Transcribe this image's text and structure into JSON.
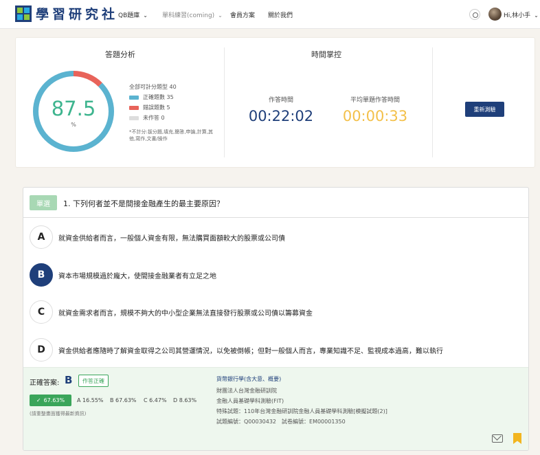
{
  "header": {
    "logo_text": "學習研究社",
    "nav": [
      {
        "label": "QB題庫",
        "has_caret": true
      },
      {
        "label": "單科練習(coming)",
        "has_caret": true
      },
      {
        "label": "會員方案"
      },
      {
        "label": "關於我們"
      }
    ],
    "user_greeting": "Hi,林小手"
  },
  "analysis": {
    "title": "答題分析",
    "score": "87.5",
    "score_unit": "%",
    "total_label": "全部可計分題型 40",
    "legend": [
      {
        "label": "正確題數 35",
        "color": "#5bb3d0"
      },
      {
        "label": "錯誤題數 5",
        "color": "#e8635a"
      },
      {
        "label": "未作答 0",
        "color": "#dddddd"
      }
    ],
    "gauge": {
      "correct": 35,
      "wrong": 5,
      "unanswered": 0,
      "total": 40
    },
    "note": "*不計分:拔分題,填充,簡答,申論,計算,其他,寫作,文書/操作"
  },
  "time": {
    "title": "時間掌控",
    "elapsed_label": "作答時間",
    "elapsed_value": "00:22:02",
    "avg_label": "平均單題作答時間",
    "avg_value": "00:00:33",
    "elapsed_color": "#1f3f7a",
    "avg_color": "#f3c04a"
  },
  "retest_label": "重新測驗",
  "question": {
    "type": "單選",
    "text": "1. 下列何者並不是間接金融產生的最主要原因？",
    "options": [
      {
        "letter": "A",
        "text": "就資金供給者而言，一般個人資金有限，無法購買面額較大的股票或公司債"
      },
      {
        "letter": "B",
        "text": "資本市場規模過於龐大，使間接金融業者有立足之地"
      },
      {
        "letter": "C",
        "text": "就資金需求者而言，規模不夠大的中小型企業無法直接發行股票或公司債以籌募資金"
      },
      {
        "letter": "D",
        "text": "資金供給者應隨時了解資金取得之公司其營運情況，以免被倒帳；但對一般個人而言，專業知識不足、監視成本過高，難以執行"
      }
    ],
    "selected": "B"
  },
  "answer": {
    "label": "正確答案:",
    "letter": "B",
    "result_tag": "作答正確",
    "correct_rate": "67.63%",
    "distribution": [
      "A 16.55%",
      "B 67.63%",
      "C 6.47%",
      "D 8.63%"
    ],
    "refresh_note": "(請重整畫面獲得最新資訊)",
    "meta_title": "貨幣銀行學(含大意、概要)",
    "meta_lines": [
      "財團法人台灣金融研訓院",
      "金融人員基礎學科測驗(FIT)",
      "特殊試題：110年台灣金融研訓院金融人員基礎學科測驗[模擬試題(2)]",
      "試題編號：Q00030432　試卷編號：EM00001350"
    ]
  }
}
